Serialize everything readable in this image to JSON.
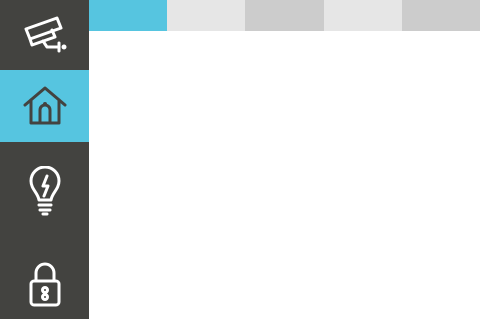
{
  "sidebar": {
    "items": [
      {
        "icon": "security-camera-icon",
        "active": false
      },
      {
        "icon": "home-icon",
        "active": true
      },
      {
        "icon": "light-bulb-icon",
        "active": false
      },
      {
        "icon": "padlock-icon",
        "active": false
      }
    ]
  },
  "top_tabs": [
    {
      "state": "active",
      "color": "#56c5e0"
    },
    {
      "state": "inactive",
      "color": "#e6e6e6"
    },
    {
      "state": "inactive",
      "color": "#cccccc"
    },
    {
      "state": "inactive",
      "color": "#e6e6e6"
    },
    {
      "state": "inactive",
      "color": "#cccccc"
    }
  ],
  "colors": {
    "sidebar_bg": "#434340",
    "accent": "#56c5e0",
    "icon_dark": "#434340",
    "icon_light": "#ffffff",
    "content_bg": "#ffffff"
  }
}
